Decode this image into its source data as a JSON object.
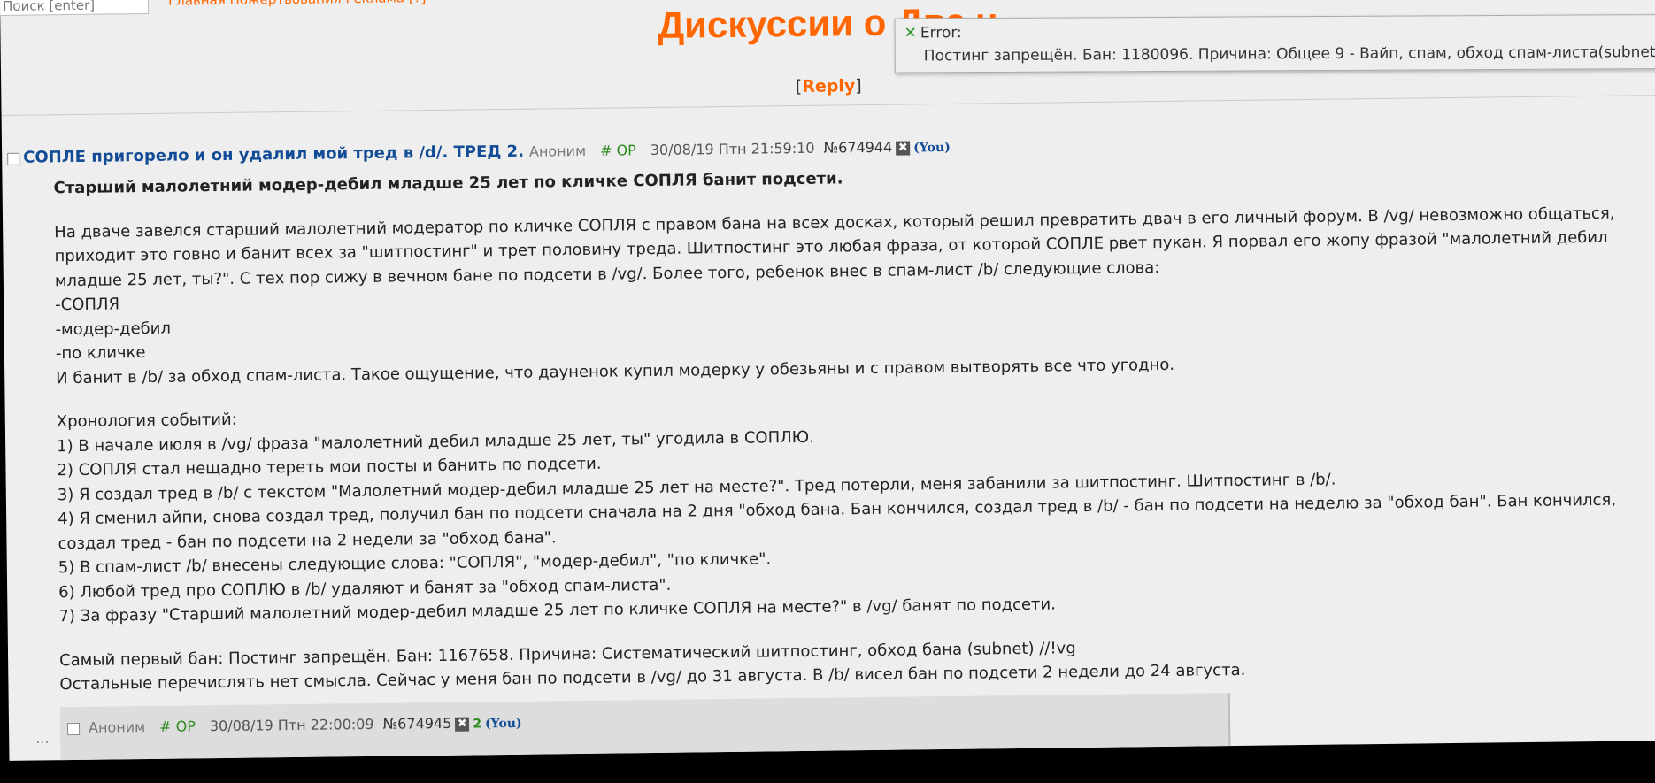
{
  "search": {
    "placeholder": "Поиск [enter]"
  },
  "topnav": {
    "text": "Главная Пожертвования Реклама [?]"
  },
  "board": {
    "title": "Дискуссии о Два.ч"
  },
  "reply_link": {
    "open": "[",
    "label": "Reply",
    "close": "]"
  },
  "error": {
    "label": "Error:",
    "message": "Постинг запрещён. Бан: 1180096. Причина: Общее 9 - Вайп, спам, обход спам-листа(subnet)"
  },
  "op_post": {
    "subject": "СОПЛЕ пригорело и он удалил мой тред в /d/. ТРЕД 2.",
    "poster": "Аноним",
    "op_tag": "# OP",
    "date": "30/08/19 Птн 21:59:10",
    "number": "№674944",
    "you": "(You)",
    "lines": [
      {
        "text": "Старший малолетний модер-дебил младше 25 лет по кличке СОПЛЯ банит подсети.",
        "bold": true
      },
      {
        "text": ""
      },
      {
        "text": "На дваче завелся старший малолетний модератор по кличке СОПЛЯ с правом бана на всех досках, который решил превратить двач в его личный форум. В /vg/ невозможно общаться,"
      },
      {
        "text": "приходит это говно и банит всех за \"шитпостинг\" и трет половину треда. Шитпостинг это любая фраза, от которой СОПЛЕ рвет пукан. Я порвал его жопу фразой \"малолетний дебил"
      },
      {
        "text": "младше 25 лет, ты?\". С тех пор сижу в вечном бане по подсети в /vg/. Более того, ребенок внес в спам-лист /b/ следующие слова:"
      },
      {
        "text": "-СОПЛЯ"
      },
      {
        "text": "-модер-дебил"
      },
      {
        "text": "-по кличке"
      },
      {
        "text": "И банит в /b/ за обход спам-листа. Такое ощущение, что дауненок купил модерку у обезьяны и с правом вытворять все что угодно."
      },
      {
        "text": ""
      },
      {
        "text": "Хронология событий:"
      },
      {
        "text": "1) В начале июля в /vg/ фраза \"малолетний дебил младше 25 лет, ты\" угодила в СОПЛЮ."
      },
      {
        "text": "2) СОПЛЯ стал нещадно тереть мои посты и банить по подсети."
      },
      {
        "text": "3) Я создал тред в /b/ с текстом \"Малолетний модер-дебил младше 25 лет на месте?\". Тред потерли, меня забанили за шитпостинг. Шитпостинг в /b/."
      },
      {
        "text": "4) Я сменил айпи, снова создал тред, получил бан по подсети сначала на 2 дня \"обход бана. Бан кончился, создал тред в /b/ - бан по подсети на неделю за \"обход бан\". Бан кончился,"
      },
      {
        "text": "создал тред - бан по подсети на 2 недели за \"обход бана\"."
      },
      {
        "text": "5) В спам-лист /b/ внесены следующие слова: \"СОПЛЯ\", \"модер-дебил\", \"по кличке\"."
      },
      {
        "text": "6) Любой тред про СОПЛЮ в /b/ удаляют и банят за \"обход спам-листа\"."
      },
      {
        "text": "7) За фразу \"Старший малолетний модер-дебил младше 25 лет по кличке СОПЛЯ на месте?\" в /vg/ банят по подсети."
      },
      {
        "text": ""
      },
      {
        "text": "Самый первый бан: Постинг запрещён. Бан: 1167658. Причина: Систематический шитпостинг, обход бана (subnet) //!vg"
      },
      {
        "text": "Остальные перечислять нет смысла. Сейчас у меня бан по подсети в /vg/ до 31 августа. В /b/ висел бан по подсети 2 недели до 24 августа."
      }
    ]
  },
  "reply_post": {
    "poster": "Аноним",
    "op_tag": "# OP",
    "date": "30/08/19 Птн 22:00:09",
    "number": "№674945",
    "reply_count": "2",
    "you": "(You)"
  }
}
